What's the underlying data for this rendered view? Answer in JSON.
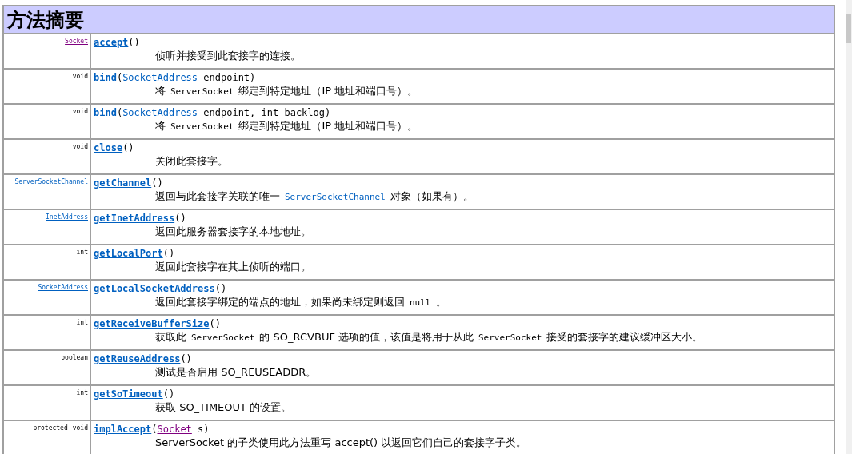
{
  "title": "方法摘要",
  "rows": [
    {
      "return": [
        {
          "text": "Socket",
          "kind": "visited"
        }
      ],
      "method": "accept",
      "params": [
        {
          "text": "()",
          "kind": "plain"
        }
      ],
      "description": [
        {
          "text": "侦听并接受到此套接字的连接。",
          "kind": "text"
        }
      ]
    },
    {
      "return": [
        {
          "text": "void",
          "kind": "plain"
        }
      ],
      "method": "bind",
      "params": [
        {
          "text": "(",
          "kind": "plain"
        },
        {
          "text": "SocketAddress",
          "kind": "link"
        },
        {
          "text": " endpoint)",
          "kind": "plain"
        }
      ],
      "description": [
        {
          "text": "将",
          "kind": "text"
        },
        {
          "text": "ServerSocket",
          "kind": "code"
        },
        {
          "text": "绑定到特定地址（IP 地址和端口号）。",
          "kind": "text"
        }
      ]
    },
    {
      "return": [
        {
          "text": "void",
          "kind": "plain"
        }
      ],
      "method": "bind",
      "params": [
        {
          "text": "(",
          "kind": "plain"
        },
        {
          "text": "SocketAddress",
          "kind": "link"
        },
        {
          "text": " endpoint, int backlog)",
          "kind": "plain"
        }
      ],
      "description": [
        {
          "text": "将",
          "kind": "text"
        },
        {
          "text": "ServerSocket",
          "kind": "code"
        },
        {
          "text": "绑定到特定地址（IP 地址和端口号）。",
          "kind": "text"
        }
      ]
    },
    {
      "return": [
        {
          "text": "void",
          "kind": "plain"
        }
      ],
      "method": "close",
      "params": [
        {
          "text": "()",
          "kind": "plain"
        }
      ],
      "description": [
        {
          "text": "关闭此套接字。",
          "kind": "text"
        }
      ]
    },
    {
      "return": [
        {
          "text": "ServerSocketChannel",
          "kind": "link"
        }
      ],
      "method": "getChannel",
      "params": [
        {
          "text": "()",
          "kind": "plain"
        }
      ],
      "description": [
        {
          "text": "返回与此套接字关联的唯一",
          "kind": "text"
        },
        {
          "text": "ServerSocketChannel",
          "kind": "link"
        },
        {
          "text": "对象（如果有）。",
          "kind": "text"
        }
      ]
    },
    {
      "return": [
        {
          "text": "InetAddress",
          "kind": "link"
        }
      ],
      "method": "getInetAddress",
      "params": [
        {
          "text": "()",
          "kind": "plain"
        }
      ],
      "description": [
        {
          "text": "返回此服务器套接字的本地地址。",
          "kind": "text"
        }
      ]
    },
    {
      "return": [
        {
          "text": "int",
          "kind": "plain"
        }
      ],
      "method": "getLocalPort",
      "params": [
        {
          "text": "()",
          "kind": "plain"
        }
      ],
      "description": [
        {
          "text": "返回此套接字在其上侦听的端口。",
          "kind": "text"
        }
      ]
    },
    {
      "return": [
        {
          "text": "SocketAddress",
          "kind": "link"
        }
      ],
      "method": "getLocalSocketAddress",
      "params": [
        {
          "text": "()",
          "kind": "plain"
        }
      ],
      "description": [
        {
          "text": "返回此套接字绑定的端点的地址，如果尚未绑定则返回",
          "kind": "text"
        },
        {
          "text": "null",
          "kind": "code"
        },
        {
          "text": "。",
          "kind": "text"
        }
      ]
    },
    {
      "return": [
        {
          "text": "int",
          "kind": "plain"
        }
      ],
      "method": "getReceiveBufferSize",
      "params": [
        {
          "text": "()",
          "kind": "plain"
        }
      ],
      "description": [
        {
          "text": "获取此",
          "kind": "text"
        },
        {
          "text": "ServerSocket",
          "kind": "code"
        },
        {
          "text": "的 SO_RCVBUF 选项的值，该值是将用于从此",
          "kind": "text"
        },
        {
          "text": "ServerSocket",
          "kind": "code"
        },
        {
          "text": "接受的套接字的建议缓冲区大小。",
          "kind": "text"
        }
      ]
    },
    {
      "return": [
        {
          "text": "boolean",
          "kind": "plain"
        }
      ],
      "method": "getReuseAddress",
      "params": [
        {
          "text": "()",
          "kind": "plain"
        }
      ],
      "description": [
        {
          "text": "测试是否启用 SO_REUSEADDR。",
          "kind": "text"
        }
      ]
    },
    {
      "return": [
        {
          "text": "int",
          "kind": "plain"
        }
      ],
      "method": "getSoTimeout",
      "params": [
        {
          "text": "()",
          "kind": "plain"
        }
      ],
      "description": [
        {
          "text": "获取 SO_TIMEOUT 的设置。",
          "kind": "text"
        }
      ]
    },
    {
      "return": [
        {
          "text": "protected",
          "kind": "plain"
        },
        {
          "text": "void",
          "kind": "plain"
        }
      ],
      "method": "implAccept",
      "params": [
        {
          "text": "(",
          "kind": "plain"
        },
        {
          "text": "Socket",
          "kind": "visited"
        },
        {
          "text": " s)",
          "kind": "plain"
        }
      ],
      "description": [
        {
          "text": "ServerSocket 的子类使用此方法重写 accept() 以返回它们自己的套接字子类。",
          "kind": "text"
        }
      ]
    }
  ]
}
